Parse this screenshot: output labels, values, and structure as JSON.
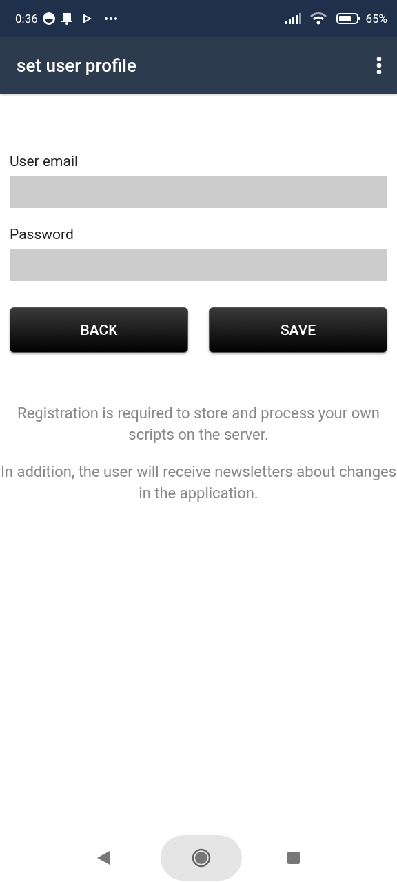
{
  "status_bar": {
    "time": "0:36",
    "battery": "65%"
  },
  "app_bar": {
    "title": "set user profile"
  },
  "fields": [
    {
      "label": "User email"
    },
    {
      "label": "Password"
    }
  ],
  "buttons": [
    "BACK",
    "SAVE"
  ],
  "notes": [
    "Registration is required to store and process your own scripts on the server.",
    "In addition, the user will receive newsletters about changes in the application."
  ]
}
